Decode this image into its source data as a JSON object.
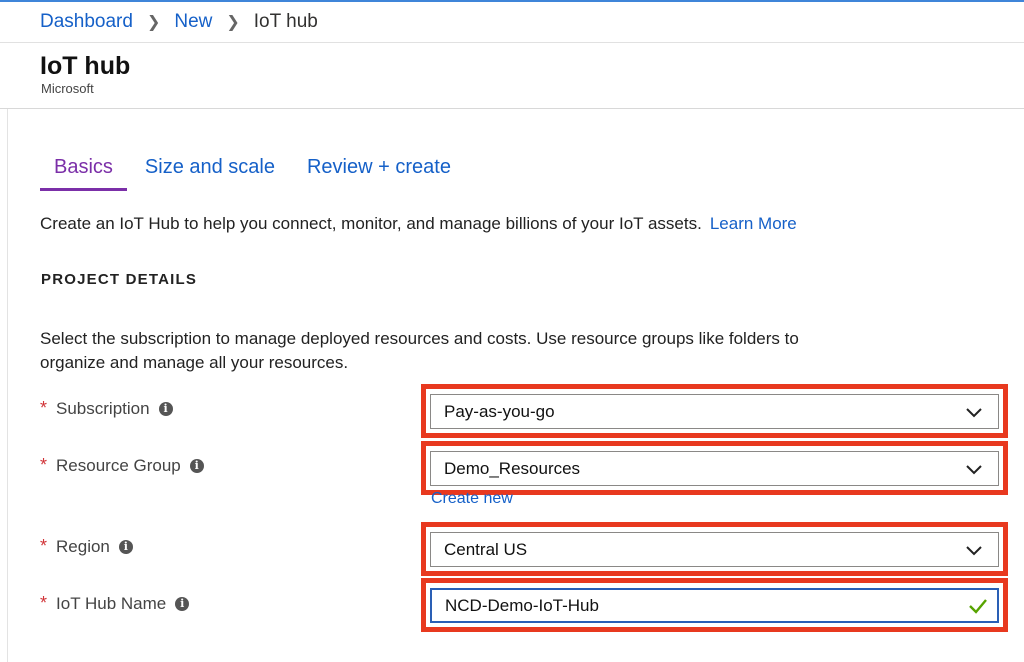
{
  "breadcrumb": {
    "items": [
      "Dashboard",
      "New"
    ],
    "current": "IoT hub"
  },
  "header": {
    "title": "IoT hub",
    "subtitle": "Microsoft"
  },
  "tabs": [
    {
      "label": "Basics",
      "active": true
    },
    {
      "label": "Size and scale",
      "active": false
    },
    {
      "label": "Review + create",
      "active": false
    }
  ],
  "intro": {
    "text": "Create an IoT Hub to help you connect, monitor, and manage billions of your IoT assets.",
    "link": "Learn More"
  },
  "project": {
    "title": "PROJECT DETAILS",
    "description": "Select the subscription to manage deployed resources and costs. Use resource groups like folders to organize and manage all your resources."
  },
  "fields": {
    "subscription": {
      "label": "Subscription",
      "value": "Pay-as-you-go"
    },
    "resource_group": {
      "label": "Resource Group",
      "value": "Demo_Resources",
      "create_new": "Create new"
    },
    "region": {
      "label": "Region",
      "value": "Central US"
    },
    "hub_name": {
      "label": "IoT Hub Name",
      "value": "NCD-Demo-IoT-Hub"
    }
  },
  "required_mark": "*",
  "info_glyph": "i",
  "colors": {
    "link": "#1560c8",
    "active_tab": "#7b2fa8",
    "highlight": "#e8391f",
    "valid_check": "#57a300",
    "required": "#d13438"
  },
  "icons": {
    "dropdown": "chevron-down-icon",
    "valid": "checkmark-icon",
    "info": "info-icon",
    "separator": "chevron-right-icon"
  }
}
